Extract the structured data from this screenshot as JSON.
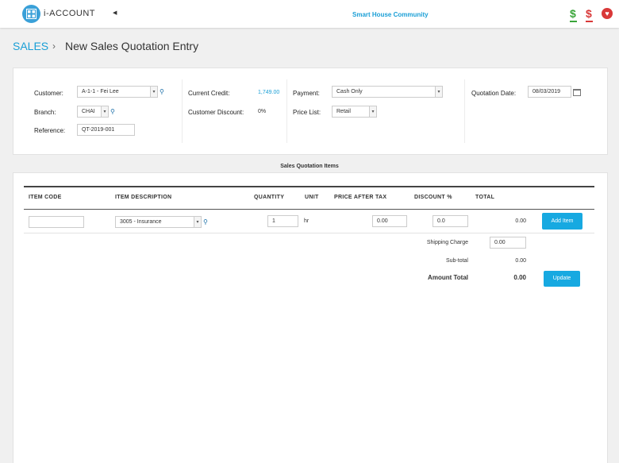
{
  "header": {
    "logo_text": "i-ACCOUNT",
    "community": "Smart House Community",
    "icons": [
      "collapse-arrow-icon",
      "dollar-green-icon",
      "dollar-red-icon",
      "heart-icon"
    ],
    "colors": {
      "accent": "#1a9fd6",
      "button": "#17a9e1",
      "green": "#3aa53a",
      "red": "#d93838"
    }
  },
  "breadcrumb": {
    "root": "SALES",
    "separator": "›",
    "title": "New Sales Quotation Entry"
  },
  "form": {
    "customer_label": "Customer:",
    "customer_value": "A-1-1 - Fei Lee",
    "branch_label": "Branch:",
    "branch_value": "CHAI",
    "reference_label": "Reference:",
    "reference_value": "QT-2019-001",
    "current_credit_label": "Current Credit:",
    "current_credit_value": "1,749.00",
    "customer_discount_label": "Customer Discount:",
    "customer_discount_value": "0%",
    "payment_label": "Payment:",
    "payment_value": "Cash Only",
    "price_list_label": "Price List:",
    "price_list_value": "Retail",
    "quotation_date_label": "Quotation Date:",
    "quotation_date_value": "08/03/2019"
  },
  "items": {
    "title": "Sales Quotation Items",
    "columns": [
      "ITEM CODE",
      "ITEM DESCRIPTION",
      "QUANTITY",
      "UNIT",
      "PRICE AFTER TAX",
      "DISCOUNT %",
      "TOTAL"
    ],
    "row": {
      "item_code": "",
      "description": "3005 - Insurance",
      "quantity": "1",
      "unit": "hr",
      "price": "0.00",
      "discount": "0.0",
      "total": "0.00"
    },
    "add_item_label": "Add Item",
    "shipping_label": "Shipping Charge",
    "shipping_value": "0.00",
    "subtotal_label": "Sub-total",
    "subtotal_value": "0.00",
    "amount_total_label": "Amount Total",
    "amount_total_value": "0.00",
    "update_label": "Update"
  }
}
